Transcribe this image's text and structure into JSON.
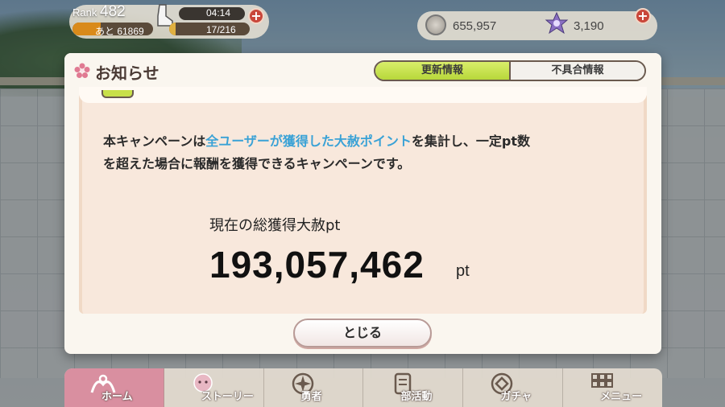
{
  "hud": {
    "rank_label": "Rank",
    "rank_value": "482",
    "exp_remaining": "あと 61869",
    "stamina_timer": "04:14",
    "stamina": "17/216",
    "stamina_fraction": 0.08,
    "coins": "655,957",
    "gems": "3,190"
  },
  "modal": {
    "title": "お知らせ",
    "tabs": [
      {
        "label": "更新情報",
        "active": true
      },
      {
        "label": "不具合情報",
        "active": false
      }
    ],
    "body_line1_part1": "本キャンペーンは",
    "body_line1_highlight": "全ユーザーが獲得した大赦ポイント",
    "body_line1_part2": "を集計し、一定pt数",
    "body_line2": "を超えた場合に報酬を獲得できるキャンペーンです。",
    "points_caption": "現在の総獲得大赦pt",
    "points_value": "193,057,462",
    "points_unit": "pt",
    "close_label": "とじる"
  },
  "nav": {
    "items": [
      {
        "label": "ホーム",
        "icon": "home-icon",
        "active": true
      },
      {
        "label": "ストーリー",
        "icon": "story-icon",
        "active": false
      },
      {
        "label": "勇者",
        "icon": "hero-icon",
        "active": false
      },
      {
        "label": "部活動",
        "icon": "club-icon",
        "active": false
      },
      {
        "label": "ガチャ",
        "icon": "gacha-icon",
        "active": false
      },
      {
        "label": "メニュー",
        "icon": "menu-icon",
        "active": false
      }
    ]
  },
  "colors": {
    "highlight": "#3aa2d6",
    "tab_active": "#c8e04a",
    "nav_active": "#d98fa0",
    "plus_button": "#c9463a"
  }
}
